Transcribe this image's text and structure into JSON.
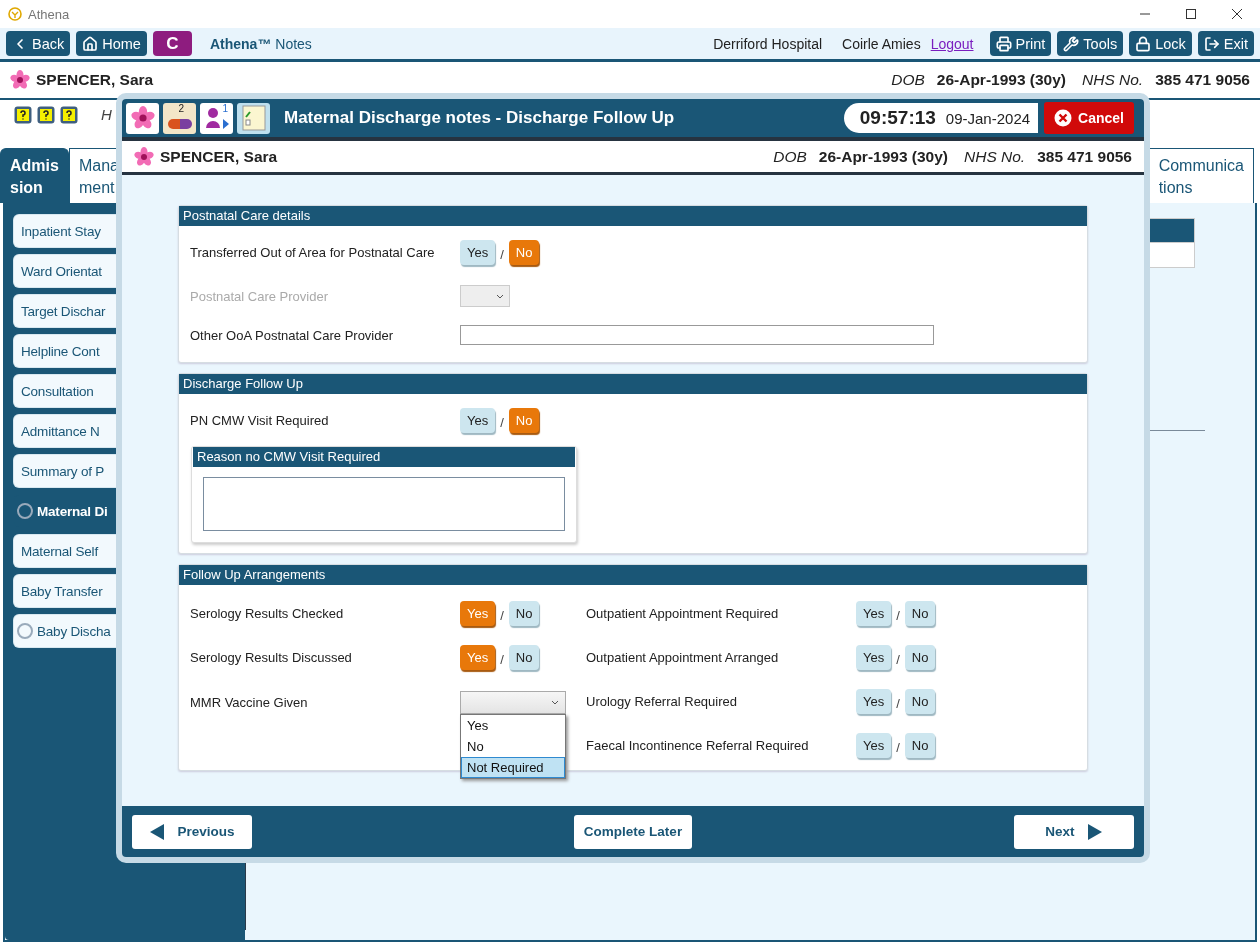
{
  "window": {
    "title": "Athena"
  },
  "toolbar": {
    "left_buttons": [
      {
        "kind": "back",
        "label": "Back"
      },
      {
        "kind": "home",
        "label": "Home"
      }
    ],
    "badge": "C",
    "app_name": "**Athena™** Notes",
    "hospital": "Derriford Hospital",
    "user": "Coirle Amies",
    "logout": "Logout",
    "right_buttons": [
      {
        "kind": "print",
        "label": "Print"
      },
      {
        "kind": "tools",
        "label": "Tools"
      },
      {
        "kind": "lock",
        "label": "Lock"
      },
      {
        "kind": "exit",
        "label": "Exit"
      }
    ]
  },
  "patient": {
    "name": "SPENCER, Sara",
    "dob_label": "DOB",
    "dob": "26-Apr-1993 (30y)",
    "nhs_label": "NHS No.",
    "nhs": "385 471 9056"
  },
  "help_text": "H",
  "tabs": [
    {
      "lines": [
        "Admis",
        "sion"
      ],
      "selected": true
    },
    {
      "lines": [
        "Mana",
        "ment"
      ],
      "selected": false
    },
    {
      "lines": [
        "Communica",
        "tions"
      ],
      "selected": false
    }
  ],
  "sidebar": {
    "items": [
      {
        "label": "Inpatient Stay",
        "selected": false,
        "marked": false
      },
      {
        "label": "Ward Orientat",
        "selected": false,
        "marked": false
      },
      {
        "label": "Target Dischar",
        "selected": false,
        "marked": false
      },
      {
        "label": "Helpline Cont",
        "selected": false,
        "marked": false
      },
      {
        "label": "Consultation",
        "selected": false,
        "marked": false
      },
      {
        "label": "Admittance N",
        "selected": false,
        "marked": false
      },
      {
        "label": "Summary of P",
        "selected": false,
        "marked": false
      },
      {
        "label": "Maternal Di",
        "selected": true,
        "marked": true
      },
      {
        "label": "Maternal Self",
        "selected": false,
        "marked": false
      },
      {
        "label": "Baby Transfer",
        "selected": false,
        "marked": false
      },
      {
        "label": "Baby Discha",
        "selected": false,
        "marked": true
      }
    ]
  },
  "modal": {
    "icons": [
      {
        "kind": "flower"
      },
      {
        "kind": "pill",
        "count": "2"
      },
      {
        "kind": "person",
        "count": "1"
      },
      {
        "kind": "notes"
      }
    ],
    "title": "Maternal Discharge notes - Discharge Follow Up",
    "time": "09:57:13",
    "date": "09-Jan-2024",
    "cancel": "Cancel",
    "patient": {
      "name": "SPENCER, Sara",
      "dob_label": "DOB",
      "dob": "26-Apr-1993 (30y)",
      "nhs_label": "NHS No.",
      "nhs": "385 471 9056"
    },
    "sections": [
      {
        "title": "Postnatal Care details",
        "fields": [
          {
            "kind": "toggle",
            "label": "Transferred Out of Area for Postnatal Care",
            "separator": "/",
            "options": [
              {
                "label": "Yes",
                "selected": false
              },
              {
                "label": "No",
                "selected": true
              }
            ]
          },
          {
            "kind": "select",
            "label": "Postnatal Care Provider",
            "disabled": true
          },
          {
            "kind": "text",
            "label": "Other OoA Postnatal Care Provider"
          }
        ]
      },
      {
        "title": "Discharge Follow Up",
        "fields": [
          {
            "kind": "toggle",
            "label": "PN CMW Visit Required",
            "separator": "/",
            "options": [
              {
                "label": "Yes",
                "selected": false
              },
              {
                "label": "No",
                "selected": true
              }
            ]
          },
          {
            "kind": "textarea",
            "label": "Reason no CMW Visit Required"
          }
        ]
      },
      {
        "title": "Follow Up Arrangements",
        "columns": [
          [
            {
              "kind": "toggle",
              "label": "Serology Results Checked",
              "separator": "/",
              "options": [
                {
                  "label": "Yes",
                  "selected": true
                },
                {
                  "label": "No",
                  "selected": false
                }
              ]
            },
            {
              "kind": "toggle",
              "label": "Serology Results Discussed",
              "separator": "/",
              "options": [
                {
                  "label": "Yes",
                  "selected": true
                },
                {
                  "label": "No",
                  "selected": false
                }
              ]
            },
            {
              "kind": "dropdown",
              "label": "MMR Vaccine Given",
              "expanded": true,
              "options": [
                {
                  "label": "Yes",
                  "selected": false
                },
                {
                  "label": "No",
                  "selected": false
                },
                {
                  "label": "Not Required",
                  "selected": true
                }
              ]
            }
          ],
          [
            {
              "kind": "toggle",
              "label": "Outpatient Appointment Required",
              "separator": "/",
              "options": [
                {
                  "label": "Yes",
                  "selected": false
                },
                {
                  "label": "No",
                  "selected": false
                }
              ]
            },
            {
              "kind": "toggle",
              "label": "Outpatient Appointment Arranged",
              "separator": "/",
              "options": [
                {
                  "label": "Yes",
                  "selected": false
                },
                {
                  "label": "No",
                  "selected": false
                }
              ]
            },
            {
              "kind": "toggle",
              "label": "Urology Referral Required",
              "separator": "/",
              "options": [
                {
                  "label": "Yes",
                  "selected": false
                },
                {
                  "label": "No",
                  "selected": false
                }
              ]
            },
            {
              "kind": "toggle",
              "label": "Faecal Incontinence Referral Required",
              "separator": "/",
              "options": [
                {
                  "label": "Yes",
                  "selected": false
                },
                {
                  "label": "No",
                  "selected": false
                }
              ]
            }
          ]
        ]
      }
    ],
    "footer": {
      "previous": "Previous",
      "complete_later": "Complete Later",
      "next": "Next"
    }
  }
}
